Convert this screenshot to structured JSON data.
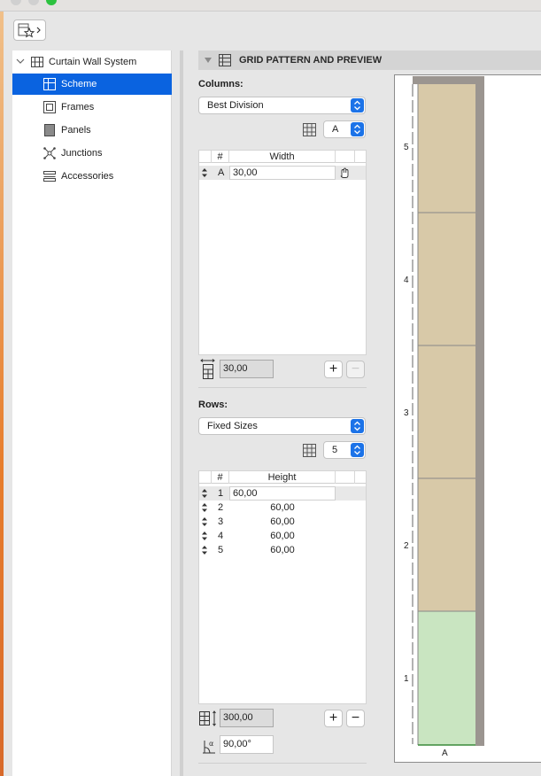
{
  "sidebar": {
    "items": [
      {
        "label": "Curtain Wall System",
        "icon": "curtain-wall-icon"
      },
      {
        "label": "Scheme",
        "icon": "scheme-icon"
      },
      {
        "label": "Frames",
        "icon": "frames-icon"
      },
      {
        "label": "Panels",
        "icon": "panels-icon"
      },
      {
        "label": "Junctions",
        "icon": "junctions-icon"
      },
      {
        "label": "Accessories",
        "icon": "accessories-icon"
      }
    ]
  },
  "section": {
    "title": "GRID PATTERN AND PREVIEW"
  },
  "columns": {
    "label": "Columns:",
    "mode": "Best Division",
    "selector_value": "A",
    "table": {
      "headers": [
        "#",
        "Width"
      ],
      "rows": [
        {
          "id": "A",
          "value": "30,00"
        }
      ]
    },
    "total": "30,00"
  },
  "rows": {
    "label": "Rows:",
    "mode": "Fixed Sizes",
    "count": "5",
    "table": {
      "headers": [
        "#",
        "Height"
      ],
      "rows": [
        {
          "id": "1",
          "value": "60,00"
        },
        {
          "id": "2",
          "value": "60,00"
        },
        {
          "id": "3",
          "value": "60,00"
        },
        {
          "id": "4",
          "value": "60,00"
        },
        {
          "id": "5",
          "value": "60,00"
        }
      ]
    },
    "total": "300,00",
    "angle": "90,00°"
  },
  "buttons": {
    "add": "+",
    "remove": "−"
  },
  "preview": {
    "row_labels": [
      "5",
      "4",
      "3",
      "2",
      "1"
    ],
    "column_label": "A",
    "colors": {
      "panel": "#d8c9a8",
      "selected_panel": "#c9e5c1",
      "frame": "#9b9590"
    }
  }
}
